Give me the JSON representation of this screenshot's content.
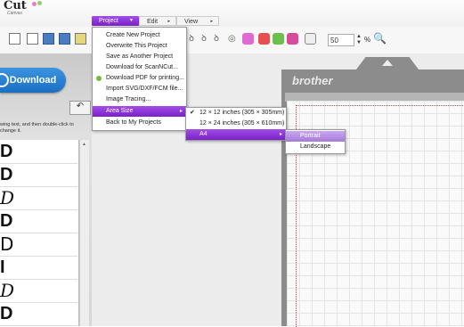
{
  "app": {
    "logo_text": "Cut",
    "logo_sub": "Canvas",
    "logo_dot_colors": [
      "#e87fc0",
      "#8fd06a"
    ]
  },
  "tabs": [
    {
      "label": "Project",
      "arrow": "▼"
    },
    {
      "label": "Edit",
      "arrow": "▸"
    },
    {
      "label": "View",
      "arrow": "▸"
    }
  ],
  "toolbar": {
    "zoom_value": "50",
    "zoom_unit": "%"
  },
  "left": {
    "download_label": "Download",
    "undo_glyph": "↶",
    "hint": "wing text, and then double-click to change it.",
    "fonts": [
      "D",
      "D",
      "D",
      "D",
      "D",
      "I",
      "D",
      "D"
    ]
  },
  "mat": {
    "brand": "brother"
  },
  "menus": {
    "project": [
      {
        "label": "Create New Project"
      },
      {
        "label": "Overwrite This Project"
      },
      {
        "label": "Save as Another Project"
      },
      {
        "label": "Download for ScanNCut..."
      },
      {
        "label": "Download PDF for printing..."
      },
      {
        "label": "Import SVG/DXF/FCM file..."
      },
      {
        "label": "Image Tracing..."
      },
      {
        "label": "Area Size",
        "sub": "▸"
      },
      {
        "label": "Back to My Projects"
      }
    ],
    "area_size": [
      {
        "label": "12 × 12 inches (305 × 305mm)",
        "check": "✔"
      },
      {
        "label": "12 × 24 inches (305 × 610mm)"
      },
      {
        "label": "A4",
        "sub": "▸"
      }
    ],
    "a4": [
      {
        "label": "Portrait"
      },
      {
        "label": "Landscape"
      }
    ]
  },
  "colors": {
    "accent": "#8a35d8",
    "download": "#1f74c8"
  }
}
